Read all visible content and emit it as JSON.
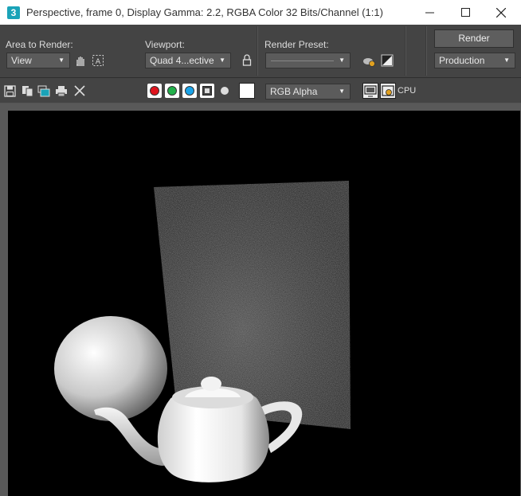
{
  "window": {
    "app_icon_label": "3",
    "title": "Perspective, frame 0, Display Gamma: 2.2, RGBA Color 32 Bits/Channel (1:1)"
  },
  "controls": {
    "area_to_render": {
      "label": "Area to Render:",
      "value": "View"
    },
    "viewport": {
      "label": "Viewport:",
      "value": "Quad 4...ective"
    },
    "render_preset": {
      "label": "Render Preset:",
      "value": ""
    },
    "render_button": "Render",
    "production_value": "Production"
  },
  "toolbar": {
    "channel_display": "RGB Alpha",
    "renderer_label": "CPU",
    "channels": [
      {
        "name": "red",
        "color": "#e0141e"
      },
      {
        "name": "green",
        "color": "#22b04b"
      },
      {
        "name": "blue",
        "color": "#1aa3e8"
      }
    ]
  },
  "render_image": {
    "description_objects": [
      "teapot",
      "sphere",
      "plane"
    ]
  }
}
